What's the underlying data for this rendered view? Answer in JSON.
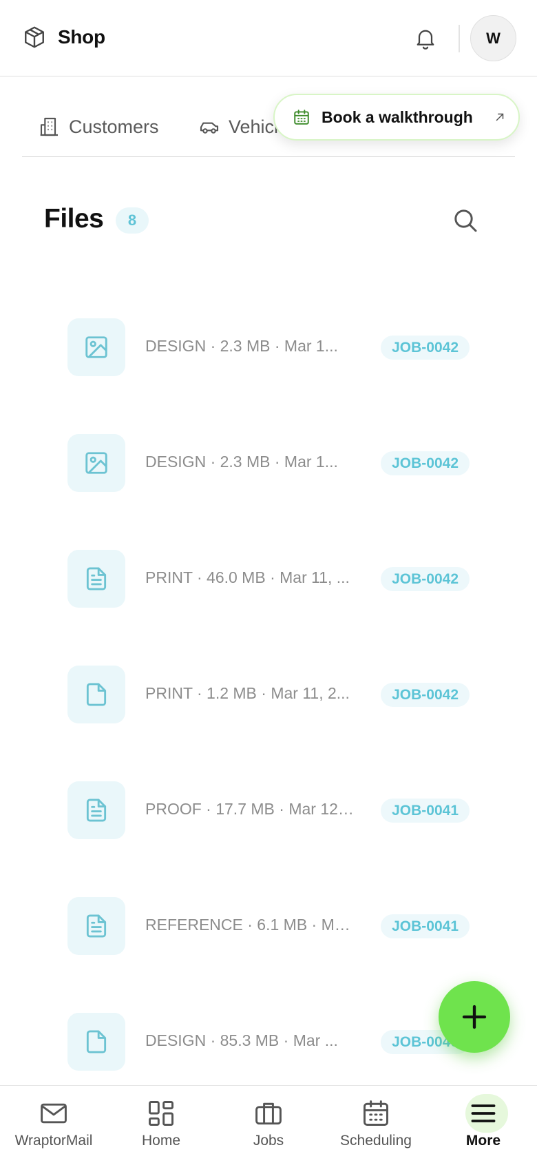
{
  "header": {
    "brand_name": "Shop",
    "avatar_initial": "W"
  },
  "tabs": [
    {
      "label": "Customers",
      "icon": "building-icon"
    },
    {
      "label": "Vehicles",
      "icon": "car-icon"
    },
    {
      "label": "",
      "icon": ""
    }
  ],
  "walkthrough": {
    "label": "Book a walkthrough",
    "accent": "#3d8b2a"
  },
  "files": {
    "title": "Files",
    "count": "8",
    "items": [
      {
        "meta": "DESIGN · 2.3 MB · Mar 1...",
        "job": "JOB-0042",
        "icon": "image-icon"
      },
      {
        "meta": "DESIGN · 2.3 MB · Mar 1...",
        "job": "JOB-0042",
        "icon": "image-icon"
      },
      {
        "meta": "PRINT · 46.0 MB · Mar 11, ...",
        "job": "JOB-0042",
        "icon": "document-text-icon"
      },
      {
        "meta": "PRINT · 1.2 MB · Mar 11, 2...",
        "job": "JOB-0042",
        "icon": "file-icon"
      },
      {
        "meta": "PROOF · 17.7 MB · Mar 12, ...",
        "job": "JOB-0041",
        "icon": "document-text-icon"
      },
      {
        "meta": "REFERENCE · 6.1 MB · Ma...",
        "job": "JOB-0041",
        "icon": "document-text-icon"
      },
      {
        "meta": "DESIGN · 85.3 MB · Mar ...",
        "job": "JOB-0040",
        "icon": "file-icon"
      }
    ]
  },
  "bottom_nav": {
    "items": [
      {
        "label": "WraptorMail",
        "icon": "mail-icon",
        "active": false
      },
      {
        "label": "Home",
        "icon": "grid-icon",
        "active": false
      },
      {
        "label": "Jobs",
        "icon": "briefcase-icon",
        "active": false
      },
      {
        "label": "Scheduling",
        "icon": "calendar-icon",
        "active": false
      },
      {
        "label": "More",
        "icon": "menu-icon",
        "active": true
      }
    ]
  },
  "colors": {
    "accent_cyan": "#5cc4d6",
    "fab_green": "#6fe34d",
    "thumb_bg": "#eaf7fa"
  }
}
